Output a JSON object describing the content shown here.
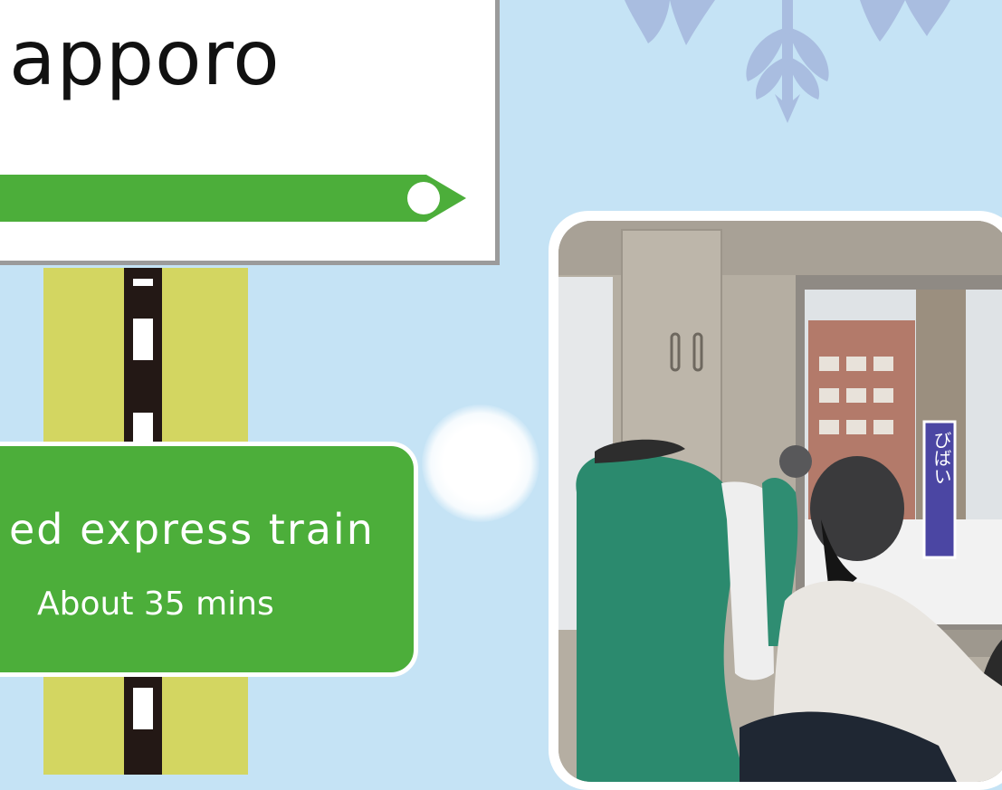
{
  "station_sign": {
    "name": "apporo"
  },
  "route_info": {
    "train_type": "ed express train",
    "travel_time": "About 35 mins"
  },
  "photo": {
    "station_board_text": "びばい",
    "board_color": "#4b46a3"
  },
  "colors": {
    "background": "#c5e3f5",
    "route_green": "#4cae3a",
    "post_yellow": "#d3d661",
    "track_dark": "#231815",
    "sign_border": "#9b9b9b",
    "snowflake": "#a9bde0"
  },
  "icons": [
    "snowflake-icon",
    "route-arrow-icon",
    "station-dot-icon"
  ]
}
